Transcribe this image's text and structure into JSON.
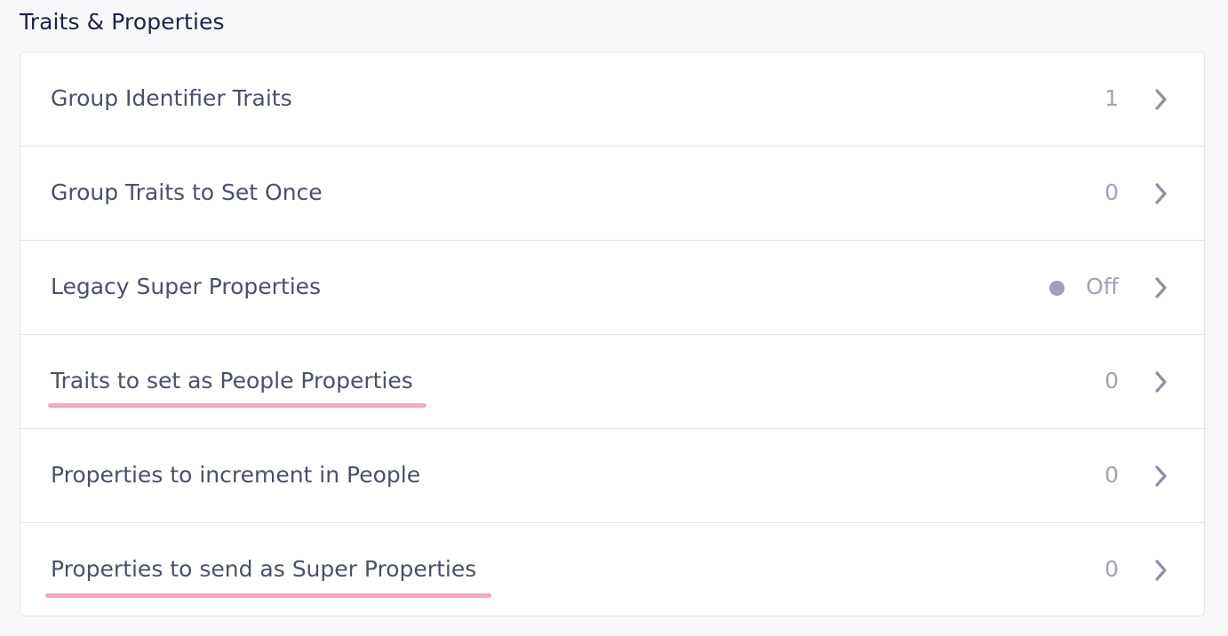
{
  "section": {
    "title": "Traits & Properties"
  },
  "rows": [
    {
      "label": "Group Identifier Traits",
      "value": "1"
    },
    {
      "label": "Group Traits to Set Once",
      "value": "0"
    },
    {
      "label": "Legacy Super Properties",
      "value": "Off",
      "status": "off"
    },
    {
      "label": "Traits to set as People Properties",
      "value": "0",
      "highlighted": true
    },
    {
      "label": "Properties to increment in People",
      "value": "0"
    },
    {
      "label": "Properties to send as Super Properties",
      "value": "0",
      "highlighted": true
    }
  ],
  "icons": {
    "chevron": "chevron-right-icon",
    "status": "status-dot-icon"
  },
  "colors": {
    "highlight_underline": "#f4a7c3",
    "status_off_dot": "#9ea2b8",
    "muted_value": "#9ea3b5"
  }
}
